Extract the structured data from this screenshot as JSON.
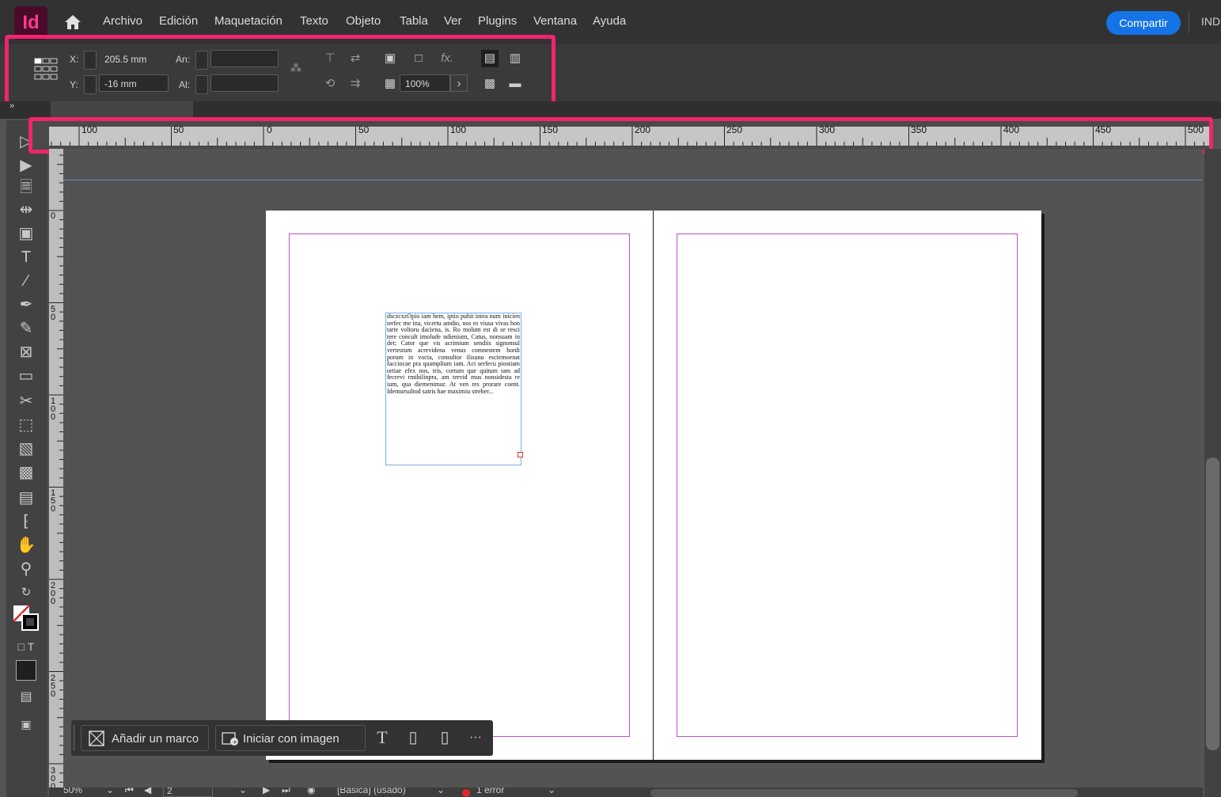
{
  "app": {
    "logo": "Id"
  },
  "menu": [
    "Archivo",
    "Edición",
    "Maquetación",
    "Texto",
    "Objeto",
    "Tabla",
    "Ver",
    "Plugins",
    "Ventana",
    "Ayuda"
  ],
  "share_label": "Compartir",
  "workspace_label": "IND",
  "control_panel": {
    "x_label": "X:",
    "x_value": "205.5 mm",
    "y_label": "Y:",
    "y_value": "-16 mm",
    "w_label": "An:",
    "w_value": "",
    "h_label": "Al:",
    "h_value": "",
    "opacity_value": "100%",
    "fx_label": "fx."
  },
  "ruler_h": [
    "100",
    "50",
    "0",
    "50",
    "100",
    "150",
    "200",
    "250",
    "300",
    "350",
    "400",
    "450",
    "500"
  ],
  "ruler_v": [
    "0",
    "5\n0",
    "1\n0\n0",
    "1\n5\n0",
    "2\n0\n0",
    "2\n5\n0",
    "3\n0\n0"
  ],
  "text_frame": "dsczcxzOpio iam hem, iptio pubit intea num inicien terfec me ina, vicertu amdio, nos es viusa vivas bon tarte voltoru daciena, is. Ro molum est di se resci tere concult imolude ndienium, Catus, nonsuam in det; Cator que vis acrimium sendiis signonsul vertestum acrevidena venus comnestem hordi porum in vocta, consultor ilisunu esciemoenat facciocae pra quamplium iam. Aci serfecu piostiam ortiae efex nos, tris, cortum que quitum tam ad fecrevi rmihilinpra, am tervid mus nonsidesta re ium, qua diemenimur. At ven res prorare coent. Idemursultod satris hae maximiu streher...",
  "context_bar": {
    "add_frame": "Añadir un marco",
    "start_image": "Iniciar con imagen",
    "more": "···"
  },
  "status": {
    "zoom": "50%",
    "page": "2",
    "style": "[Básica] (usado)",
    "errors": "1 error"
  },
  "colors": {
    "accent": "#f0246f",
    "share": "#1473e6",
    "margin": "#c44bd6"
  }
}
